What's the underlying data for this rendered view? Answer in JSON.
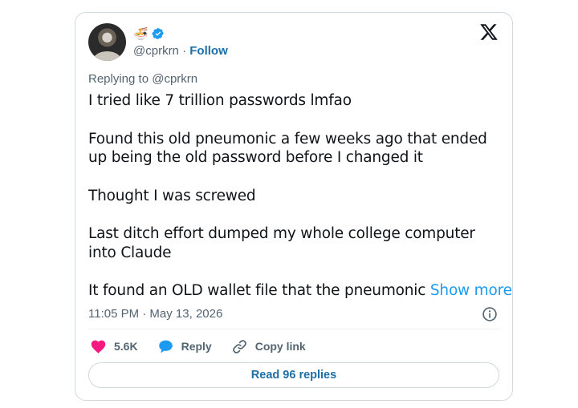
{
  "author": {
    "emoji": "🍜",
    "handle": "@cprkrn",
    "separator": "·",
    "follow_label": "Follow"
  },
  "reply_context": "Replying to @cprkrn",
  "tweet": {
    "paragraphs": [
      "I tried like 7 trillion passwords lmfao",
      "Found this old pneumonic a few weeks ago that ended up being the old password before I changed it",
      "Thought I was screwed",
      "Last ditch effort dumped my whole college computer into Claude"
    ],
    "last_line": "It found an OLD wallet file that the pneumonic ",
    "show_more": "Show more",
    "timestamp": "11:05 PM · May 13, 2026"
  },
  "actions": {
    "likes": "5.6K",
    "reply_label": "Reply",
    "copy_link_label": "Copy link"
  },
  "read_replies_label": "Read 96 replies",
  "colors": {
    "like": "#f91880",
    "reply": "#1d9bf0",
    "link": "#1d6fa5",
    "muted": "#536471",
    "verified": "#1d9bf0"
  },
  "icons": [
    "verified-badge-icon",
    "x-logo-icon",
    "info-icon",
    "heart-icon",
    "reply-bubble-icon",
    "link-icon"
  ]
}
